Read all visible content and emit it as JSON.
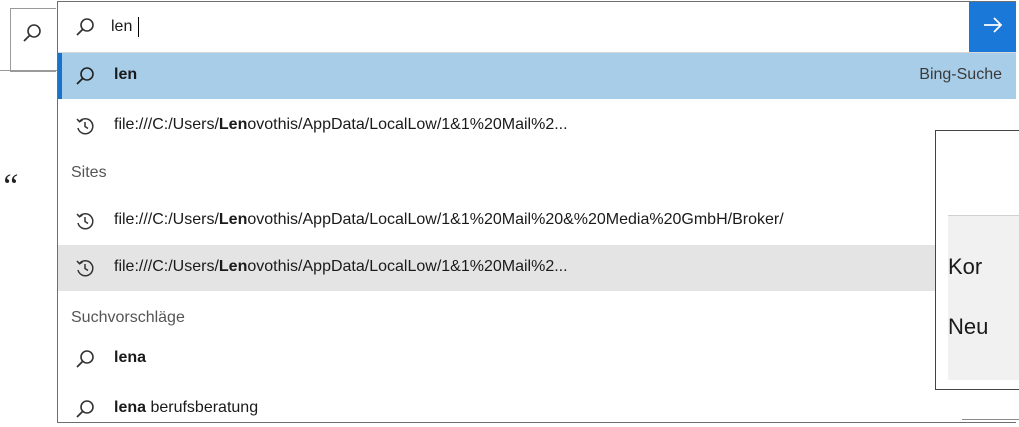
{
  "search": {
    "value": "len"
  },
  "rows": {
    "bing": {
      "query": "len",
      "right_label": "Bing-Suche"
    },
    "history1": {
      "prefix": "file:///C:/Users/",
      "bold": "Len",
      "suffix": "ovothis/AppData/LocalLow/1&1%20Mail%2..."
    },
    "history2": {
      "prefix": "file:///C:/Users/",
      "bold": "Len",
      "suffix": "ovothis/AppData/LocalLow/1&1%20Mail%20&%20Media%20GmbH/Broker/"
    },
    "history3": {
      "prefix": "file:///C:/Users/",
      "bold": "Len",
      "suffix": "ovothis/AppData/LocalLow/1&1%20Mail%2..."
    },
    "sugg1": {
      "bold": "lena",
      "rest": ""
    },
    "sugg2": {
      "bold": "lena",
      "rest": " berufsberatung"
    }
  },
  "sections": {
    "sites": "Sites",
    "suggestions": "Suchvorschläge"
  },
  "background": {
    "quote_char": "“"
  },
  "dialog": {
    "line1": "Kor",
    "line2": "Neu"
  },
  "colors": {
    "accent": "#1a79d8",
    "selected_bg": "#a8cde8",
    "hover_bg": "#e4e4e4"
  },
  "icons": {
    "search": "search-icon",
    "history": "history-icon",
    "arrow": "arrow-right-icon"
  }
}
